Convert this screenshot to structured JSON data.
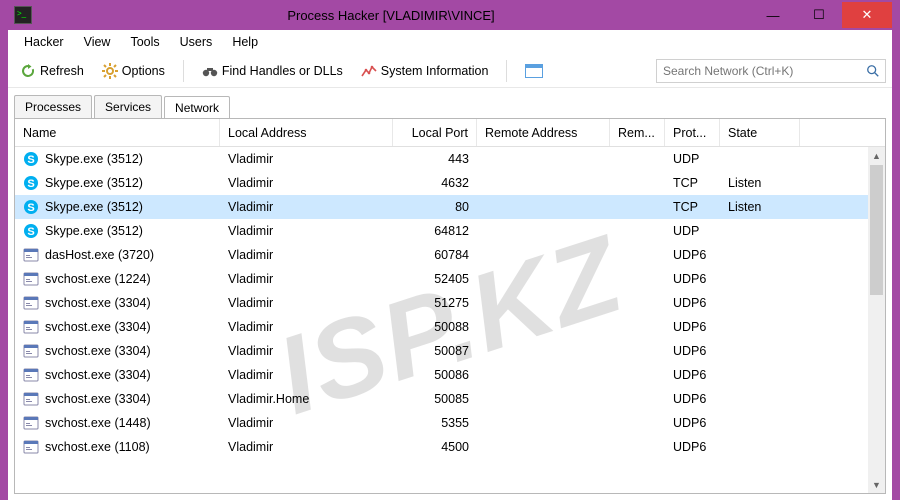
{
  "window": {
    "title": "Process Hacker [VLADIMIR\\VINCE]"
  },
  "menu": {
    "items": [
      "Hacker",
      "View",
      "Tools",
      "Users",
      "Help"
    ]
  },
  "toolbar": {
    "refresh": "Refresh",
    "options": "Options",
    "find": "Find Handles or DLLs",
    "sysinfo": "System Information"
  },
  "search": {
    "placeholder": "Search Network (Ctrl+K)"
  },
  "tabs": {
    "items": [
      "Processes",
      "Services",
      "Network"
    ],
    "active": 2
  },
  "columns": {
    "name": "Name",
    "laddr": "Local Address",
    "lport": "Local Port",
    "raddr": "Remote Address",
    "rport": "Rem...",
    "proto": "Prot...",
    "state": "State"
  },
  "rows": [
    {
      "icon": "skype",
      "name": "Skype.exe (3512)",
      "laddr": "Vladimir",
      "lport": "443",
      "raddr": "",
      "rport": "",
      "proto": "UDP",
      "state": "",
      "sel": false
    },
    {
      "icon": "skype",
      "name": "Skype.exe (3512)",
      "laddr": "Vladimir",
      "lport": "4632",
      "raddr": "",
      "rport": "",
      "proto": "TCP",
      "state": "Listen",
      "sel": false
    },
    {
      "icon": "skype",
      "name": "Skype.exe (3512)",
      "laddr": "Vladimir",
      "lport": "80",
      "raddr": "",
      "rport": "",
      "proto": "TCP",
      "state": "Listen",
      "sel": true
    },
    {
      "icon": "skype",
      "name": "Skype.exe (3512)",
      "laddr": "Vladimir",
      "lport": "64812",
      "raddr": "",
      "rport": "",
      "proto": "UDP",
      "state": "",
      "sel": false
    },
    {
      "icon": "exe",
      "name": "dasHost.exe (3720)",
      "laddr": "Vladimir",
      "lport": "60784",
      "raddr": "",
      "rport": "",
      "proto": "UDP6",
      "state": "",
      "sel": false
    },
    {
      "icon": "exe",
      "name": "svchost.exe (1224)",
      "laddr": "Vladimir",
      "lport": "52405",
      "raddr": "",
      "rport": "",
      "proto": "UDP6",
      "state": "",
      "sel": false
    },
    {
      "icon": "exe",
      "name": "svchost.exe (3304)",
      "laddr": "Vladimir",
      "lport": "51275",
      "raddr": "",
      "rport": "",
      "proto": "UDP6",
      "state": "",
      "sel": false
    },
    {
      "icon": "exe",
      "name": "svchost.exe (3304)",
      "laddr": "Vladimir",
      "lport": "50088",
      "raddr": "",
      "rport": "",
      "proto": "UDP6",
      "state": "",
      "sel": false
    },
    {
      "icon": "exe",
      "name": "svchost.exe (3304)",
      "laddr": "Vladimir",
      "lport": "50087",
      "raddr": "",
      "rport": "",
      "proto": "UDP6",
      "state": "",
      "sel": false
    },
    {
      "icon": "exe",
      "name": "svchost.exe (3304)",
      "laddr": "Vladimir",
      "lport": "50086",
      "raddr": "",
      "rport": "",
      "proto": "UDP6",
      "state": "",
      "sel": false
    },
    {
      "icon": "exe",
      "name": "svchost.exe (3304)",
      "laddr": "Vladimir.Home",
      "lport": "50085",
      "raddr": "",
      "rport": "",
      "proto": "UDP6",
      "state": "",
      "sel": false
    },
    {
      "icon": "exe",
      "name": "svchost.exe (1448)",
      "laddr": "Vladimir",
      "lport": "5355",
      "raddr": "",
      "rport": "",
      "proto": "UDP6",
      "state": "",
      "sel": false
    },
    {
      "icon": "exe",
      "name": "svchost.exe (1108)",
      "laddr": "Vladimir",
      "lport": "4500",
      "raddr": "",
      "rport": "",
      "proto": "UDP6",
      "state": "",
      "sel": false
    }
  ],
  "watermark": "ISP.KZ"
}
